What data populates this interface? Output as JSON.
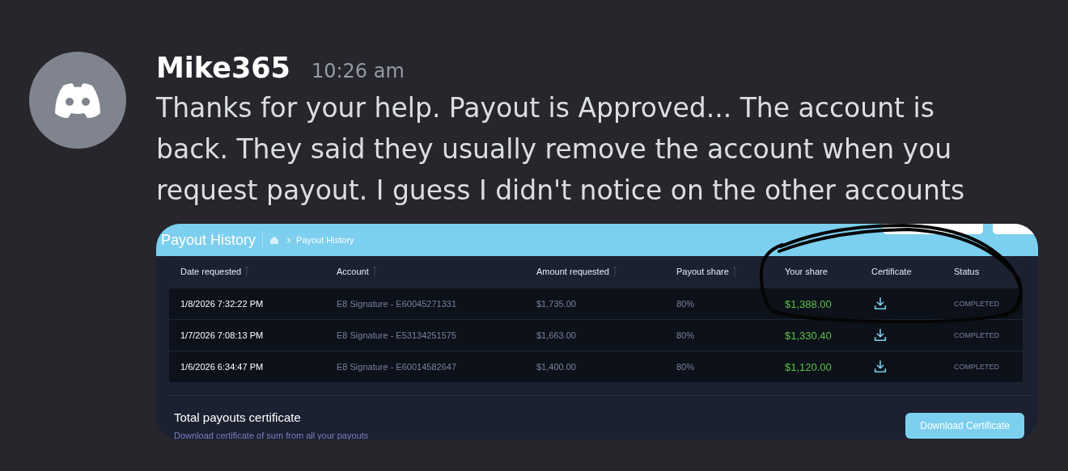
{
  "message": {
    "author": "Mike365",
    "time": "10:26 am",
    "text": "Thanks for your help. Payout is Approved... The account is back. They said they usually remove the account when you request payout. I guess I didn't notice on the other accounts"
  },
  "attachment": {
    "title": "Payout History",
    "breadcrumb": "Payout History",
    "columns": [
      {
        "label": "Date requested",
        "sortable": true
      },
      {
        "label": "Account",
        "sortable": true
      },
      {
        "label": "Amount requested",
        "sortable": true
      },
      {
        "label": "Payout share",
        "sortable": true
      },
      {
        "label": "Your share",
        "sortable": false
      },
      {
        "label": "Certificate",
        "sortable": false
      },
      {
        "label": "Status",
        "sortable": false
      }
    ],
    "rows": [
      {
        "date": "1/8/2026 7:32:22 PM",
        "account": "E8 Signature - E60045271331",
        "amount": "$1,735.00",
        "share_pct": "80%",
        "your_share": "$1,388.00",
        "status": "COMPLETED"
      },
      {
        "date": "1/7/2026 7:08:13 PM",
        "account": "E8 Signature - E53134251575",
        "amount": "$1,663.00",
        "share_pct": "80%",
        "your_share": "$1,330.40",
        "status": "COMPLETED"
      },
      {
        "date": "1/6/2026 6:34:47 PM",
        "account": "E8 Signature - E60014582647",
        "amount": "$1,400.00",
        "share_pct": "80%",
        "your_share": "$1,120.00",
        "status": "COMPLETED"
      }
    ],
    "total": {
      "title": "Total payouts certificate",
      "description": "Download certificate of sum from all your payouts",
      "button": "Download Certificate"
    }
  }
}
